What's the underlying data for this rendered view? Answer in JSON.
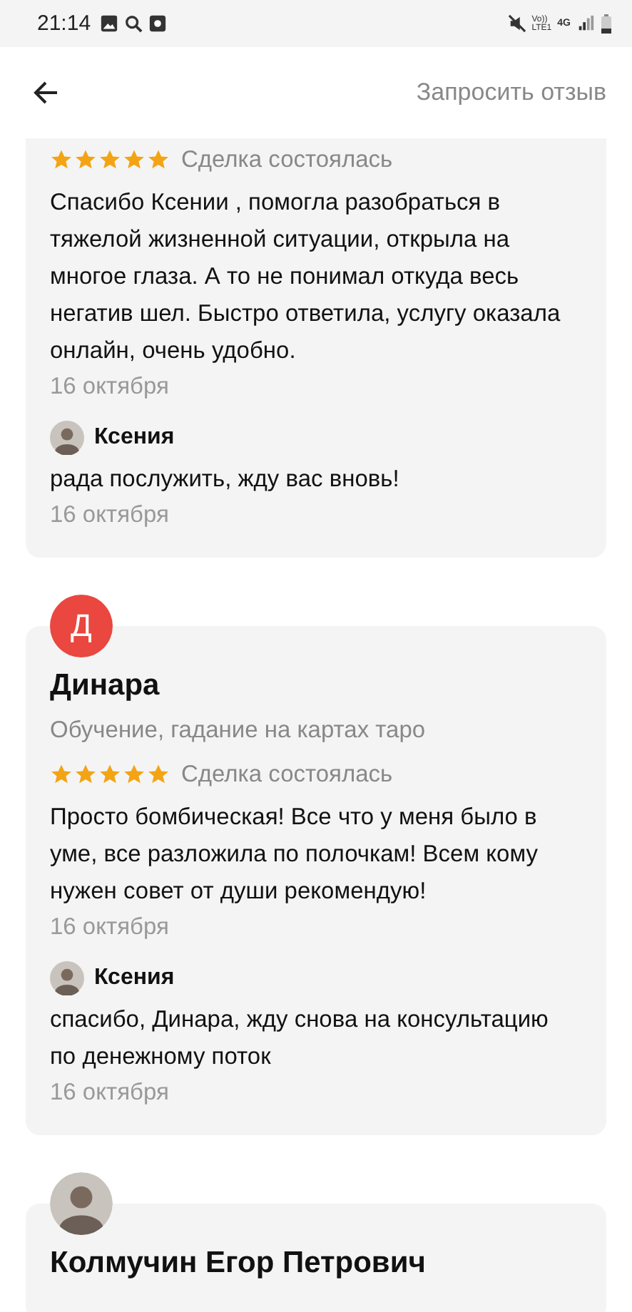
{
  "status_bar": {
    "time": "21:14",
    "volte_top": "Vo))",
    "volte_bottom": "LTE1",
    "network": "4G"
  },
  "header": {
    "action": "Запросить отзыв"
  },
  "reviews": [
    {
      "kind": "partial",
      "stars": 5,
      "deal": "Сделка состоялась",
      "text": "Спасибо Ксении , помогла разобраться в тяжелой жизненной ситуации, открыла на многое глаза. А то не понимал откуда весь негатив шел. Быстро ответила, услугу оказала онлайн, очень удобно.",
      "date": "16 октября",
      "reply": {
        "author": "Ксения",
        "text": "рада послужить, жду вас вновь!",
        "date": "16 октября"
      }
    },
    {
      "kind": "letter",
      "initial": "Д",
      "color": "#e9473f",
      "name": "Динара",
      "category": "Обучение, гадание на картах таро",
      "stars": 5,
      "deal": "Сделка состоялась",
      "text": "Просто бомбическая! Все что у меня было в уме, все разложила по полочкам! Всем кому нужен совет от души рекомендую!",
      "date": "16 октября",
      "reply": {
        "author": "Ксения",
        "text": "спасибо, Динара, жду снова на консультацию по денежному поток",
        "date": "16 октября"
      }
    },
    {
      "kind": "photo",
      "name": "Колмучин Егор Петрович"
    }
  ]
}
